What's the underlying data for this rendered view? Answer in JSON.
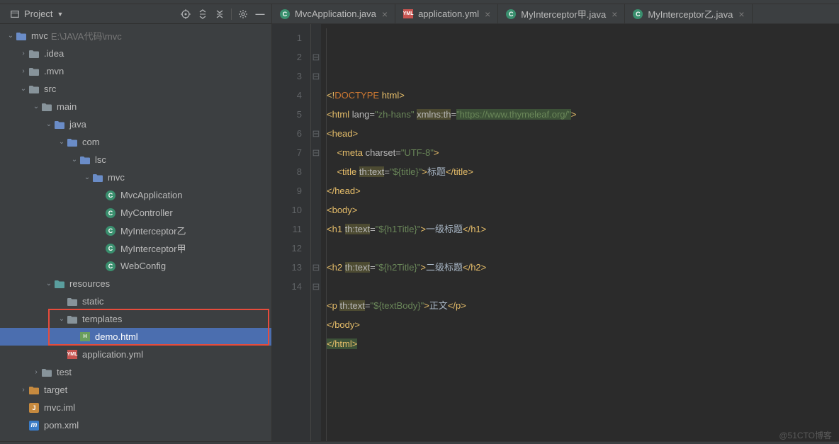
{
  "panel": {
    "title": "Project"
  },
  "tree": [
    {
      "depth": 0,
      "arrow": "down",
      "icon": "folder-blue",
      "label": "mvc",
      "path": "E:\\JAVA代码\\mvc"
    },
    {
      "depth": 1,
      "arrow": "right",
      "icon": "folder",
      "label": ".idea"
    },
    {
      "depth": 1,
      "arrow": "right",
      "icon": "folder",
      "label": ".mvn"
    },
    {
      "depth": 1,
      "arrow": "down",
      "icon": "folder",
      "label": "src"
    },
    {
      "depth": 2,
      "arrow": "down",
      "icon": "folder",
      "label": "main"
    },
    {
      "depth": 3,
      "arrow": "down",
      "icon": "folder-blue",
      "label": "java"
    },
    {
      "depth": 4,
      "arrow": "down",
      "icon": "folder-blue",
      "label": "com"
    },
    {
      "depth": 5,
      "arrow": "down",
      "icon": "folder-blue",
      "label": "lsc"
    },
    {
      "depth": 6,
      "arrow": "down",
      "icon": "folder-blue",
      "label": "mvc"
    },
    {
      "depth": 7,
      "arrow": "",
      "icon": "class",
      "label": "MvcApplication"
    },
    {
      "depth": 7,
      "arrow": "",
      "icon": "class",
      "label": "MyController"
    },
    {
      "depth": 7,
      "arrow": "",
      "icon": "class",
      "label": "MyInterceptor乙"
    },
    {
      "depth": 7,
      "arrow": "",
      "icon": "class",
      "label": "MyInterceptor甲"
    },
    {
      "depth": 7,
      "arrow": "",
      "icon": "class",
      "label": "WebConfig"
    },
    {
      "depth": 3,
      "arrow": "down",
      "icon": "folder-teal",
      "label": "resources"
    },
    {
      "depth": 4,
      "arrow": "",
      "icon": "folder",
      "label": "static"
    },
    {
      "depth": 4,
      "arrow": "down",
      "icon": "folder",
      "label": "templates",
      "hl": true
    },
    {
      "depth": 5,
      "arrow": "",
      "icon": "html",
      "label": "demo.html",
      "selected": true,
      "hl": true
    },
    {
      "depth": 4,
      "arrow": "",
      "icon": "yml",
      "label": "application.yml"
    },
    {
      "depth": 2,
      "arrow": "right",
      "icon": "folder",
      "label": "test"
    },
    {
      "depth": 1,
      "arrow": "right",
      "icon": "folder-orange",
      "label": "target"
    },
    {
      "depth": 1,
      "arrow": "",
      "icon": "iml",
      "label": "mvc.iml"
    },
    {
      "depth": 1,
      "arrow": "",
      "icon": "m",
      "label": "pom.xml"
    }
  ],
  "tabs": [
    {
      "icon": "class",
      "label": "MvcApplication.java"
    },
    {
      "icon": "yml",
      "label": "application.yml"
    },
    {
      "icon": "class",
      "label": "MyInterceptor甲.java"
    },
    {
      "icon": "class",
      "label": "MyInterceptor乙.java"
    }
  ],
  "code_lines": [
    1,
    2,
    3,
    4,
    5,
    6,
    7,
    8,
    9,
    10,
    11,
    12,
    13,
    14
  ],
  "fold": [
    "",
    "⊟",
    "⊟",
    "",
    "",
    "⊟",
    "⊟",
    "",
    "",
    "",
    "",
    "",
    "⊟",
    "⊟"
  ],
  "code": [
    "<!DOCTYPE html>",
    "<html lang=\"zh-hans\" xmlns:th=\"https://www.thymeleaf.org/\">",
    "<head>",
    "    <meta charset=\"UTF-8\">",
    "    <title th:text=\"${title}\">标题</title>",
    "</head>",
    "<body>",
    "<h1 th:text=\"${h1Title}\">一级标题</h1>",
    "",
    "<h2 th:text=\"${h2Title}\">二级标题</h2>",
    "",
    "<p th:text=\"${textBody}\">正文</p>",
    "</body>",
    "</html>"
  ],
  "watermark": "@51CTO博客"
}
